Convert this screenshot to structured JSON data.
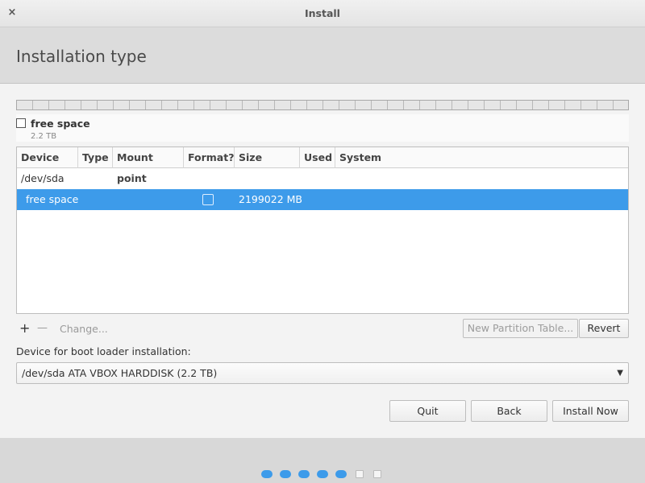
{
  "window": {
    "title": "Install",
    "close_glyph": "×"
  },
  "header": {
    "title": "Installation type"
  },
  "legend": {
    "name": "free space",
    "size": "2.2 TB"
  },
  "table": {
    "columns": [
      "Device",
      "Type",
      "Mount point",
      "Format?",
      "Size",
      "Used",
      "System"
    ],
    "rows": [
      {
        "device": "/dev/sda"
      },
      {
        "device": "free space",
        "size": "2199022 MB",
        "format": false,
        "selected": true
      }
    ]
  },
  "toolbar": {
    "add_glyph": "+",
    "remove_glyph": "—",
    "change_label": "Change...",
    "new_table_label": "New Partition Table...",
    "revert_label": "Revert"
  },
  "bootloader": {
    "label": "Device for boot loader installation:",
    "value": "/dev/sda ATA VBOX HARDDISK (2.2 TB)",
    "arrow_glyph": "▼"
  },
  "buttons": {
    "quit": "Quit",
    "back": "Back",
    "install": "Install Now"
  },
  "progress": {
    "total_steps": 7,
    "completed_steps": 5
  },
  "colors": {
    "accent": "#3d9bea"
  }
}
